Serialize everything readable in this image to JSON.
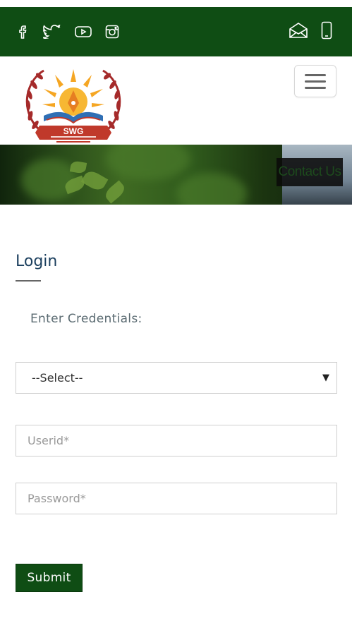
{
  "topbar": {
    "social_icons": [
      "facebook-icon",
      "twitter-icon",
      "youtube-icon",
      "instagram-icon"
    ],
    "contact_icons": [
      "mail-icon",
      "mobile-phone-icon"
    ],
    "background_color": "#0f4d14"
  },
  "header": {
    "logo_text": "SWG",
    "menu_icon": "hamburger-menu-icon"
  },
  "banner": {
    "caption": "Contact Us"
  },
  "login": {
    "title": "Login",
    "subtitle": "Enter Credentials:",
    "select_value": "--Select--",
    "userid_placeholder": "Userid*",
    "password_placeholder": "Password*",
    "submit_label": "Submit"
  }
}
